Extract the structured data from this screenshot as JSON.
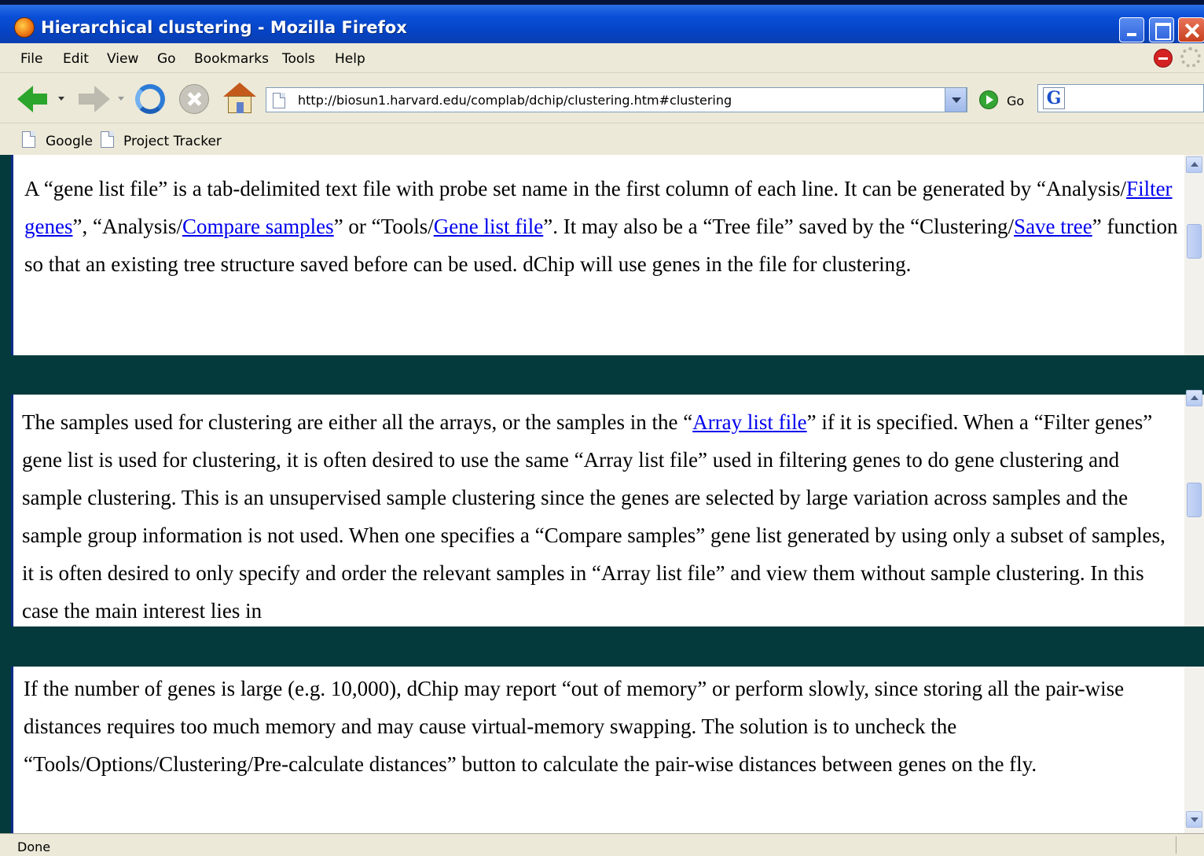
{
  "window": {
    "title": "Hierarchical clustering - Mozilla Firefox"
  },
  "menu": {
    "items": [
      "File",
      "Edit",
      "View",
      "Go",
      "Bookmarks",
      "Tools",
      "Help"
    ]
  },
  "navigation": {
    "url": "http://biosun1.harvard.edu/complab/dchip/clustering.htm#clustering",
    "go_label": "Go",
    "search_engine_glyph": "G"
  },
  "bookmarks": {
    "items": [
      "Google",
      "Project Tracker"
    ]
  },
  "content": {
    "para1": {
      "t1": "A “gene list file” is a tab-delimited text file with probe set name in the first column of each line. It can be generated by “Analysis/",
      "link1": "Filter genes",
      "t2": "”, “Analysis/",
      "link2": "Compare samples",
      "t3": "” or “Tools/",
      "link3": "Gene list file",
      "t4": "”. It may also be a “Tree file” saved by the “Clustering/",
      "link4": "Save tree",
      "t5": "” function so that an existing tree structure saved before can be used. dChip will use genes in the file for clustering."
    },
    "para2": {
      "t1": "The samples used for clustering are either all the arrays, or the samples in the “",
      "link1": "Array list file",
      "t2": "” if it is specified. When a “Filter genes” gene list is used for clustering, it is often desired to use the same “Array list file” used in filtering genes to do gene clustering and sample clustering. This is an unsupervised sample clustering since the genes are selected by large variation across samples and the sample group information is not used. When one specifies a “Compare samples” gene list generated by using only a subset of samples, it is often desired to only specify and order the relevant samples in “Array list file” and view them without sample clustering. In this case the main interest lies in"
    },
    "para3": {
      "text": "If the number of genes is large (e.g. 10,000), dChip may report “out of memory” or perform slowly, since storing all the pair-wise distances requires too much memory and may cause virtual-memory swapping. The solution is to uncheck the “Tools/Options/Clustering/Pre-calculate distances” button to calculate the pair-wise distances between genes on the fly."
    }
  },
  "status": {
    "text": "Done"
  },
  "colors": {
    "title_bar": "#0a4fd8",
    "link": "#0000ee",
    "background_band": "#043a3c",
    "chrome": "#ece9d8"
  },
  "icons": {
    "app": "firefox-icon",
    "back": "back-arrow-icon",
    "forward": "forward-arrow-icon",
    "reload": "reload-icon",
    "stop": "stop-icon",
    "home": "home-icon",
    "go": "go-icon",
    "search": "google-search-icon",
    "bookmark": "page-icon"
  }
}
